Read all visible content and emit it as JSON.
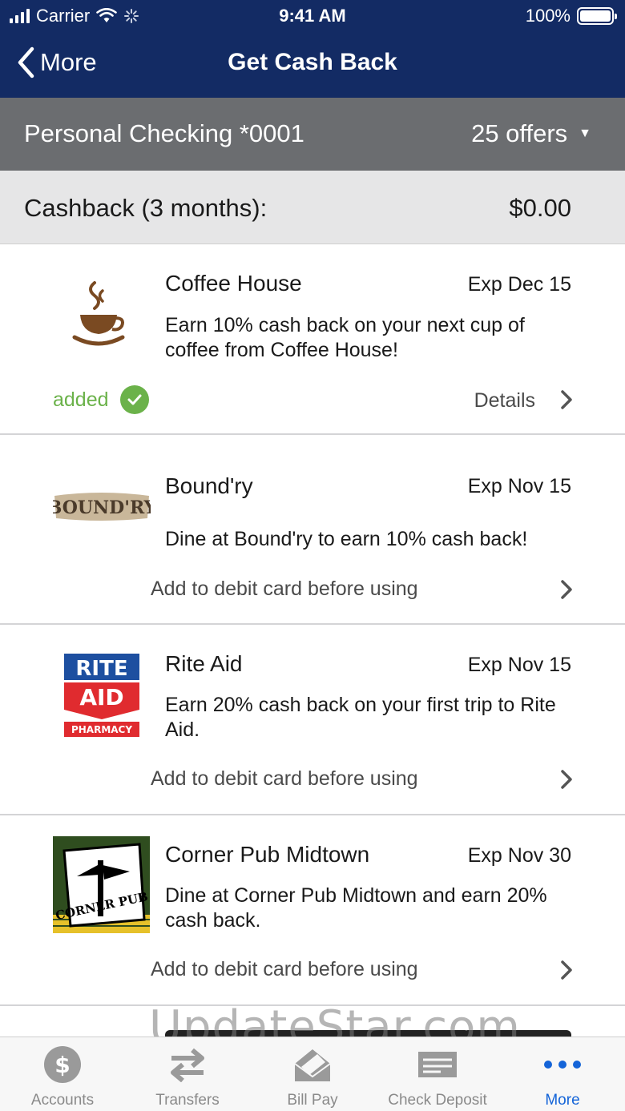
{
  "status_bar": {
    "carrier": "Carrier",
    "time": "9:41 AM",
    "battery": "100%"
  },
  "nav": {
    "back_label": "More",
    "title": "Get Cash Back"
  },
  "account": {
    "name": "Personal Checking *0001",
    "offers_count": "25 offers"
  },
  "cashback": {
    "label": "Cashback (3 months):",
    "amount": "$0.00"
  },
  "offers": [
    {
      "merchant": "Coffee House",
      "expires": "Exp Dec 15",
      "description": "Earn 10% cash back on your next cup of coffee from Coffee House!",
      "status": "added",
      "details_label": "Details",
      "logo_icon": "coffee-cup-icon"
    },
    {
      "merchant": "Bound'ry",
      "expires": "Exp Nov 15",
      "description": "Dine at Bound'ry to earn 10% cash back!",
      "action": "Add to debit card before using",
      "logo_text": "BOUND'RY"
    },
    {
      "merchant": "Rite Aid",
      "expires": "Exp Nov 15",
      "description": "Earn 20% cash back on your first trip to Rite Aid.",
      "action": "Add to debit card before using",
      "logo_text": [
        "RITE",
        "AID",
        "PHARMACY"
      ]
    },
    {
      "merchant": "Corner Pub Midtown",
      "expires": "Exp Nov 30",
      "description": "Dine at Corner Pub Midtown and earn 20% cash back.",
      "action": "Add to debit card before using",
      "logo_text": "CORNER PUB"
    }
  ],
  "watermark": "UpdateStar.com",
  "tabs": [
    {
      "label": "Accounts",
      "icon": "dollar-circle-icon",
      "active": false
    },
    {
      "label": "Transfers",
      "icon": "transfer-arrows-icon",
      "active": false
    },
    {
      "label": "Bill Pay",
      "icon": "bill-pay-icon",
      "active": false
    },
    {
      "label": "Check Deposit",
      "icon": "check-deposit-icon",
      "active": false
    },
    {
      "label": "More",
      "icon": "more-dots-icon",
      "active": true
    }
  ],
  "colors": {
    "nav_bg": "#132b64",
    "account_bg": "#6b6d70",
    "added_green": "#6bb24a",
    "active_tab": "#1464d8"
  }
}
